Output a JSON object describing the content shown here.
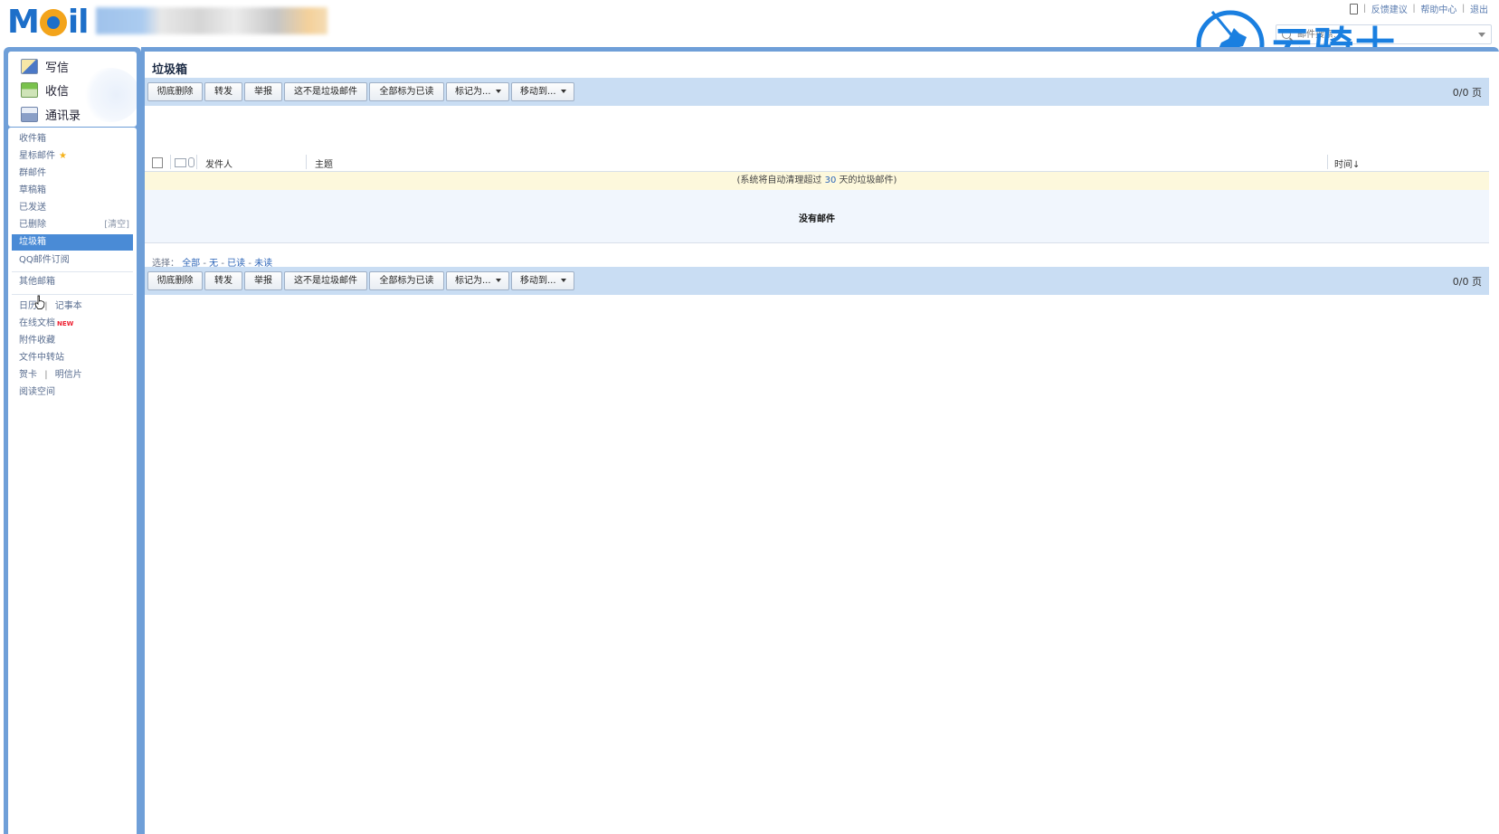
{
  "header": {
    "logo_text_left": "M",
    "logo_text_right": "il",
    "links": [
      "反馈建议",
      "帮助中心",
      "退出"
    ],
    "search_placeholder": "邮件搜索..."
  },
  "watermark": {
    "text": "云骑士"
  },
  "quick_actions": [
    {
      "label": "写信",
      "icon": "compose-icon"
    },
    {
      "label": "收信",
      "icon": "inbox-download-icon"
    },
    {
      "label": "通讯录",
      "icon": "contacts-icon"
    }
  ],
  "folders": [
    {
      "label": "收件箱"
    },
    {
      "label": "星标邮件",
      "icon": "star-icon"
    },
    {
      "label": "群邮件"
    },
    {
      "label": "草稿箱"
    },
    {
      "label": "已发送"
    },
    {
      "label": "已删除",
      "extra": "[清空]"
    },
    {
      "label": "垃圾箱",
      "active": true
    },
    {
      "label": "QQ邮件订阅"
    }
  ],
  "other_mailboxes": "其他邮箱",
  "tools": {
    "calendar": "日历",
    "notebook": "记事本",
    "docs": "在线文档",
    "docs_badge": "NEW",
    "attachments": "附件收藏",
    "file_transfer": "文件中转站",
    "greeting_card": "贺卡",
    "postcard": "明信片",
    "reading": "阅读空间",
    "separator": "|"
  },
  "main": {
    "title": "垃圾箱",
    "toolbar": {
      "delete": "彻底删除",
      "forward": "转发",
      "report": "举报",
      "not_spam": "这不是垃圾邮件",
      "mark_all_read": "全部标为已读",
      "mark_as": "标记为...",
      "move_to": "移动到..."
    },
    "pager": "0/0 页",
    "columns": {
      "sender": "发件人",
      "subject": "主题",
      "time": "时间↓"
    },
    "notice_prefix": "(系统将自动清理超过 ",
    "notice_days": "30",
    "notice_suffix": " 天的垃圾邮件)",
    "empty_text": "没有邮件",
    "select": {
      "label": "选择：",
      "all": "全部",
      "none": "无",
      "read": "已读",
      "unread": "未读",
      "sep": "-"
    }
  },
  "colors": {
    "brand_blue": "#1d6fc9",
    "frame_blue": "#6f9fd8",
    "toolbar_bg": "#c9ddf3",
    "active_folder": "#4a8bd6",
    "notice_bg": "#fdf8dc"
  }
}
